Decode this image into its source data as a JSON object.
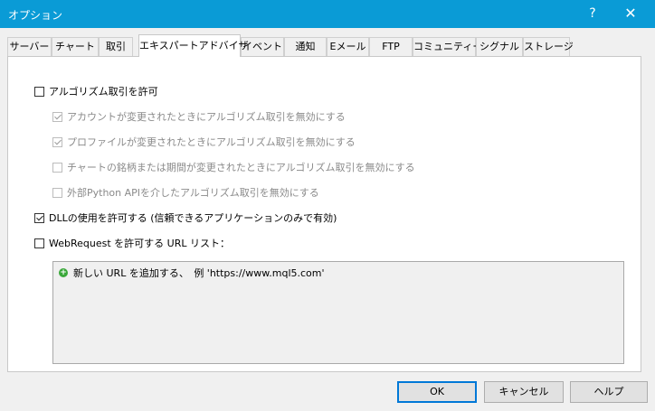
{
  "window": {
    "title": "オプション",
    "help_glyph": "?",
    "close_glyph": "✕"
  },
  "tabs": [
    {
      "label": "サーバー"
    },
    {
      "label": "チャート"
    },
    {
      "label": "取引"
    },
    {
      "label": "エキスパートアドバイザ",
      "active": true
    },
    {
      "label": "イベント"
    },
    {
      "label": "通知"
    },
    {
      "label": "Eメール"
    },
    {
      "label": "FTP"
    },
    {
      "label": "コミュニティー"
    },
    {
      "label": "シグナル"
    },
    {
      "label": "ストレージ"
    }
  ],
  "options": {
    "algo_trading": {
      "label": "アルゴリズム取引を許可",
      "checked": false
    },
    "disable_on_account_change": {
      "label": "アカウントが変更されたときにアルゴリズム取引を無効にする",
      "checked": true,
      "disabled": true
    },
    "disable_on_profile_change": {
      "label": "プロファイルが変更されたときにアルゴリズム取引を無効にする",
      "checked": true,
      "disabled": true
    },
    "disable_on_symbol_change": {
      "label": "チャートの銘柄または期間が変更されたときにアルゴリズム取引を無効にする",
      "checked": false,
      "disabled": true
    },
    "disable_python_api": {
      "label": "外部Python APIを介したアルゴリズム取引を無効にする",
      "checked": false,
      "disabled": true
    },
    "allow_dll": {
      "label": "DLLの使用を許可する (信頼できるアプリケーションのみで有効)",
      "checked": true
    },
    "webrequest": {
      "label": "WebRequest を許可する URL リスト：",
      "checked": false
    }
  },
  "url_list": {
    "add_text": "新しい URL を追加する、　例 'https://www.mql5.com'"
  },
  "buttons": {
    "ok": "OK",
    "cancel": "キャンセル",
    "help": "ヘルプ"
  },
  "colors": {
    "titlebar": "#0a9bd6",
    "accent": "#0078d7",
    "add_icon": "#3aa83a"
  }
}
